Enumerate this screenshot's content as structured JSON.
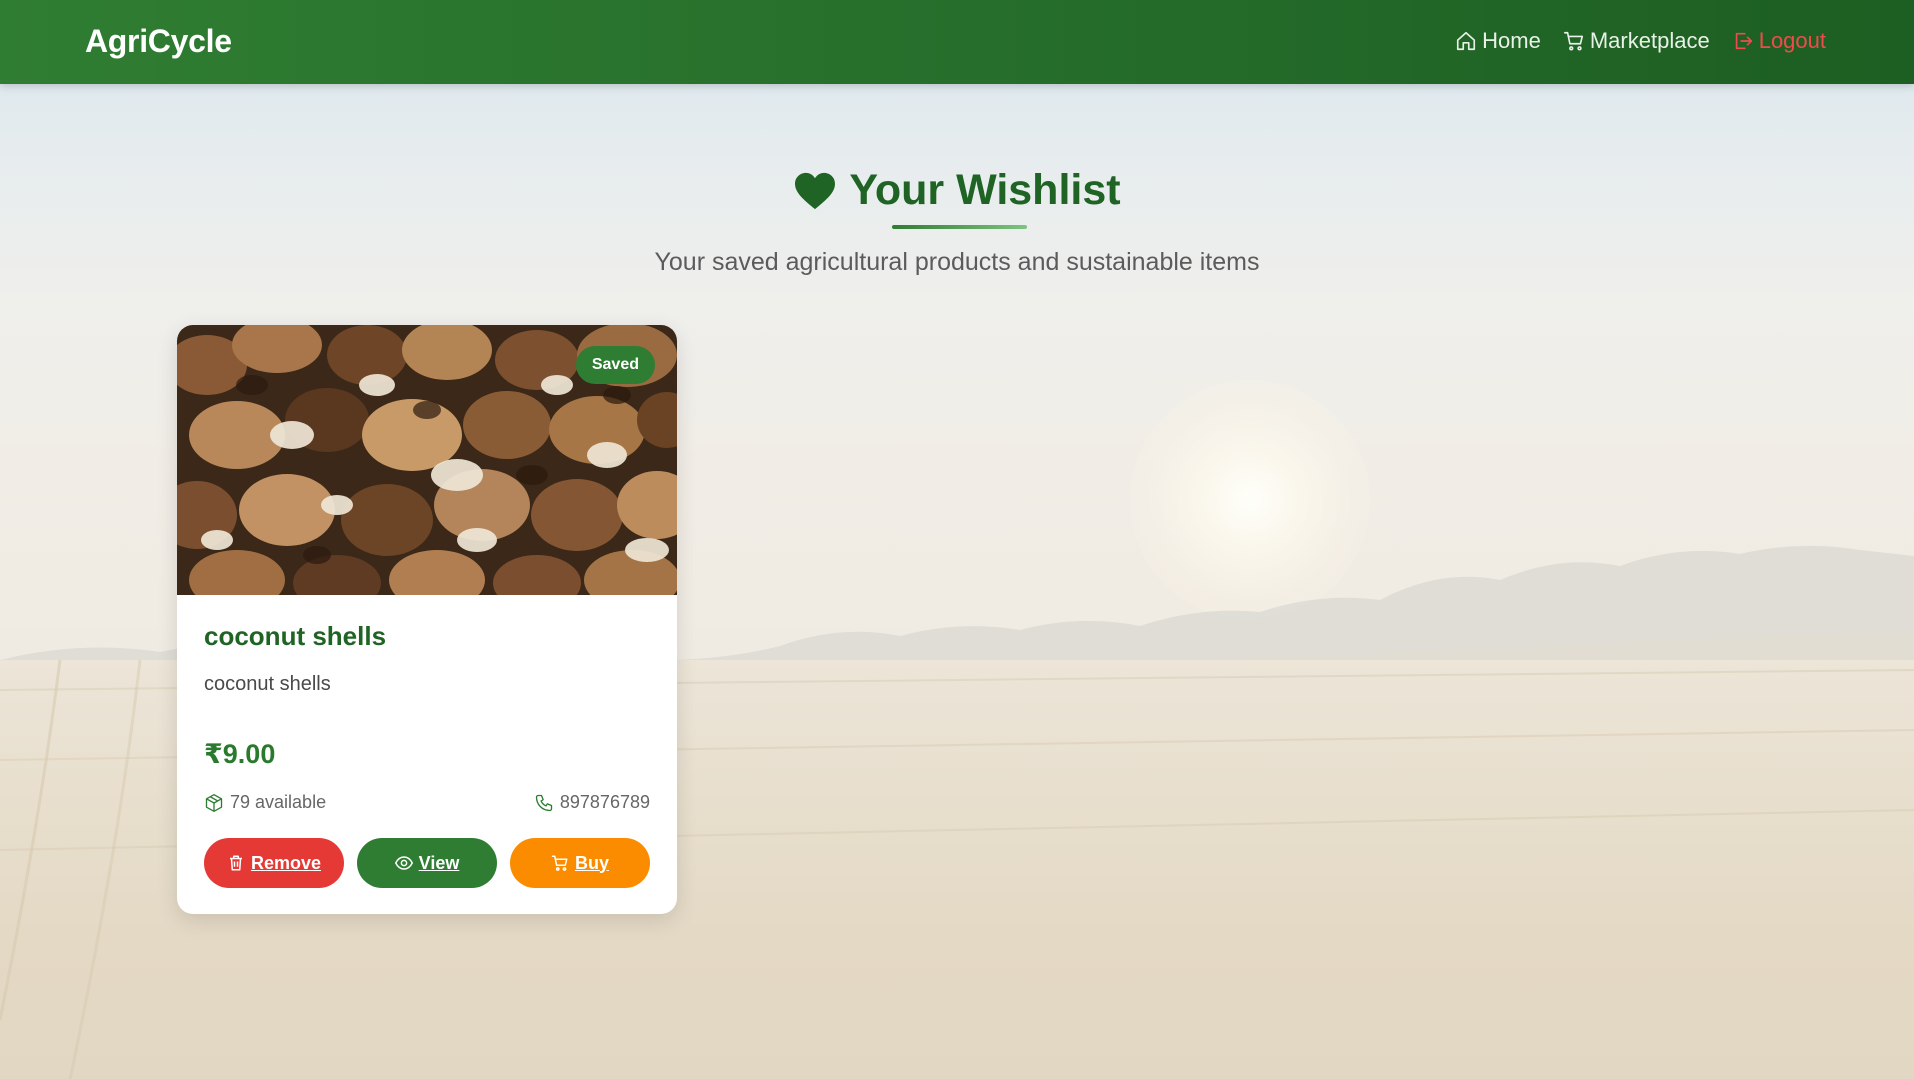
{
  "navbar": {
    "brand": "AgriCycle",
    "links": [
      {
        "label": "Home",
        "icon": "home-icon"
      },
      {
        "label": "Marketplace",
        "icon": "cart-icon"
      },
      {
        "label": "Logout",
        "icon": "logout-icon"
      }
    ]
  },
  "page": {
    "title": "Your Wishlist",
    "subtitle": "Your saved agricultural products and sustainable items"
  },
  "wishlist": [
    {
      "badge": "Saved",
      "name": "coconut shells",
      "description": "coconut shells",
      "price": "₹9.00",
      "availability": "79 available",
      "phone": "897876789",
      "actions": {
        "remove": "Remove",
        "view": "View",
        "buy": "Buy"
      }
    }
  ],
  "colors": {
    "brand_green": "#2e7d32",
    "remove_red": "#e53935",
    "buy_orange": "#fb8c00",
    "logout_red": "#ef4b4b"
  }
}
